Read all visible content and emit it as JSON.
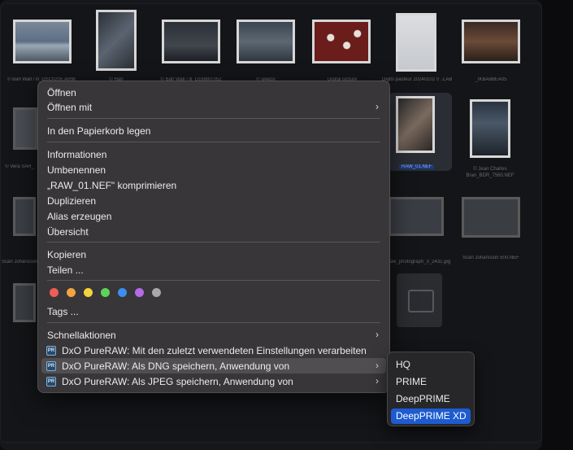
{
  "finder": {
    "captions": [
      "© Bah Wall / ill_DSC0205.ARW",
      "© Han",
      "© Bah Wall / ill_D16880.052",
      "© weeps",
      "Digital picture",
      "Digits pasteur 20240102 0 ..LABOLE..4106_NAV6.01",
      "_IKBA8BEA05",
      "© Vera SAR_",
      "RAW_01.NEF",
      "© Jean Charles Bran_BDR_7560.NEF",
      "Scan Johansson",
      "raw_photograph_3_2431.jpg",
      "Scan Johansson 500.NEF"
    ]
  },
  "menu": {
    "open": "Öffnen",
    "open_with": "Öffnen mit",
    "trash": "In den Papierkorb legen",
    "info": "Informationen",
    "rename": "Umbenennen",
    "compress": "„RAW_01.NEF\" komprimieren",
    "duplicate": "Duplizieren",
    "alias": "Alias erzeugen",
    "overview": "Übersicht",
    "copy": "Kopieren",
    "share": "Teilen ...",
    "tags": "Tags ...",
    "quick_actions": "Schnellaktionen",
    "dxo_recent": "DxO PureRAW: Mit den zuletzt verwendeten Einstellungen verarbeiten",
    "dxo_dng": "DxO PureRAW: Als DNG speichern, Anwendung von",
    "dxo_jpeg": "DxO PureRAW: Als JPEG speichern, Anwendung von",
    "pr_icon_label": "PR"
  },
  "tag_colors": [
    "#ee5d57",
    "#f2a443",
    "#f5d33d",
    "#5fd25a",
    "#3c8ef0",
    "#b36be6",
    "#a8a8a8"
  ],
  "submenu": {
    "items": [
      "HQ",
      "PRIME",
      "DeepPRIME",
      "DeepPRIME XD"
    ],
    "selected": "DeepPRIME XD"
  },
  "accent_color": "#1d5bd0"
}
